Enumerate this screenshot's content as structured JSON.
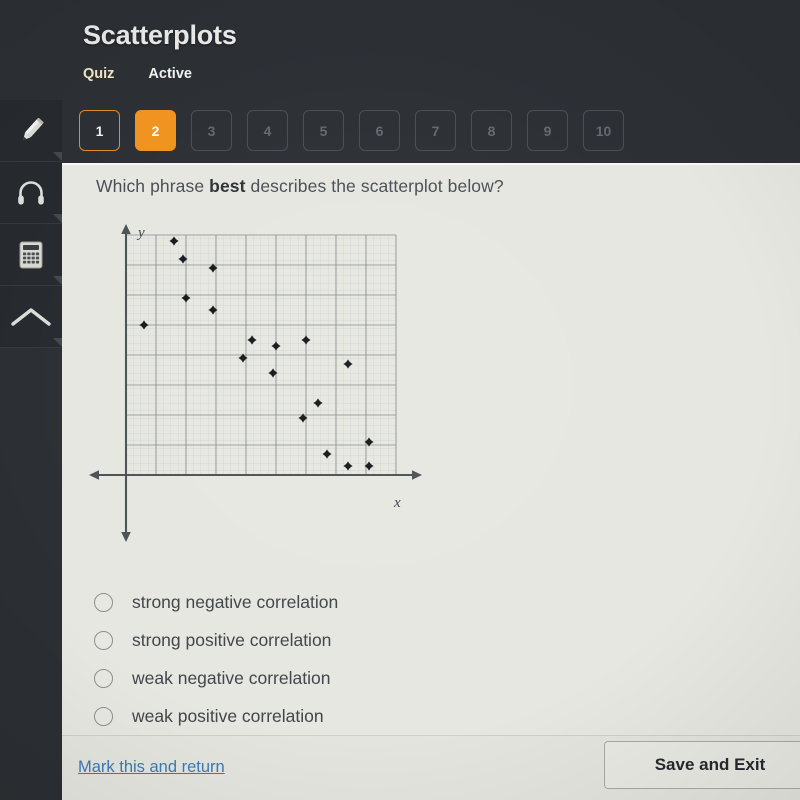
{
  "app": {
    "title": "Scatterplots",
    "category": "Quiz",
    "status": "Active"
  },
  "colors": {
    "accent_orange": "#f0931f",
    "header_bg": "#2c3035",
    "rail_bg": "#262a2e",
    "content_bg": "#e7e7e1",
    "link_blue": "#3b7ab5",
    "quiz_label": "#efe6c4",
    "point_color": "#15171a"
  },
  "sidebar": {
    "items": [
      {
        "icon": "pencil-icon",
        "label": "Highlighter"
      },
      {
        "icon": "headphones-icon",
        "label": "Audio"
      },
      {
        "icon": "calculator-icon",
        "label": "Calculator"
      },
      {
        "icon": "chevron-up-icon",
        "label": "Collapse"
      }
    ]
  },
  "question_nav": {
    "items": [
      {
        "number": "1",
        "state": "done"
      },
      {
        "number": "2",
        "state": "current"
      },
      {
        "number": "3",
        "state": "locked"
      },
      {
        "number": "4",
        "state": "locked"
      },
      {
        "number": "5",
        "state": "locked"
      },
      {
        "number": "6",
        "state": "locked"
      },
      {
        "number": "7",
        "state": "locked"
      },
      {
        "number": "8",
        "state": "locked"
      },
      {
        "number": "9",
        "state": "locked"
      },
      {
        "number": "10",
        "state": "locked"
      }
    ]
  },
  "question": {
    "prefix": "Which phrase ",
    "emphasis": "best",
    "suffix": " describes the scatterplot below?"
  },
  "choices": [
    {
      "label": "strong negative correlation",
      "selected": false
    },
    {
      "label": "strong positive correlation",
      "selected": false
    },
    {
      "label": "weak negative correlation",
      "selected": false
    },
    {
      "label": "weak positive correlation",
      "selected": false
    }
  ],
  "footer": {
    "mark_link": "Mark this and return",
    "save_button": "Save and Exit"
  },
  "chart_data": {
    "type": "scatter",
    "title": "",
    "xlabel": "x",
    "ylabel": "y",
    "xlim": [
      0,
      9
    ],
    "ylim": [
      0,
      8
    ],
    "grid": true,
    "grid_cols": 9,
    "grid_rows": 8,
    "tick_labels_x": [],
    "tick_labels_y": [],
    "legend": null,
    "series": [
      {
        "name": "data",
        "points": [
          [
            1.6,
            7.8
          ],
          [
            1.9,
            7.2
          ],
          [
            2.9,
            6.9
          ],
          [
            2.0,
            5.9
          ],
          [
            2.9,
            5.5
          ],
          [
            0.6,
            5.0
          ],
          [
            4.2,
            4.5
          ],
          [
            5.0,
            4.3
          ],
          [
            6.0,
            4.5
          ],
          [
            3.9,
            3.9
          ],
          [
            4.9,
            3.4
          ],
          [
            7.4,
            3.7
          ],
          [
            6.4,
            2.4
          ],
          [
            5.9,
            1.9
          ],
          [
            8.1,
            1.1
          ],
          [
            6.7,
            0.7
          ],
          [
            7.4,
            0.3
          ],
          [
            8.1,
            0.3
          ]
        ]
      }
    ]
  }
}
